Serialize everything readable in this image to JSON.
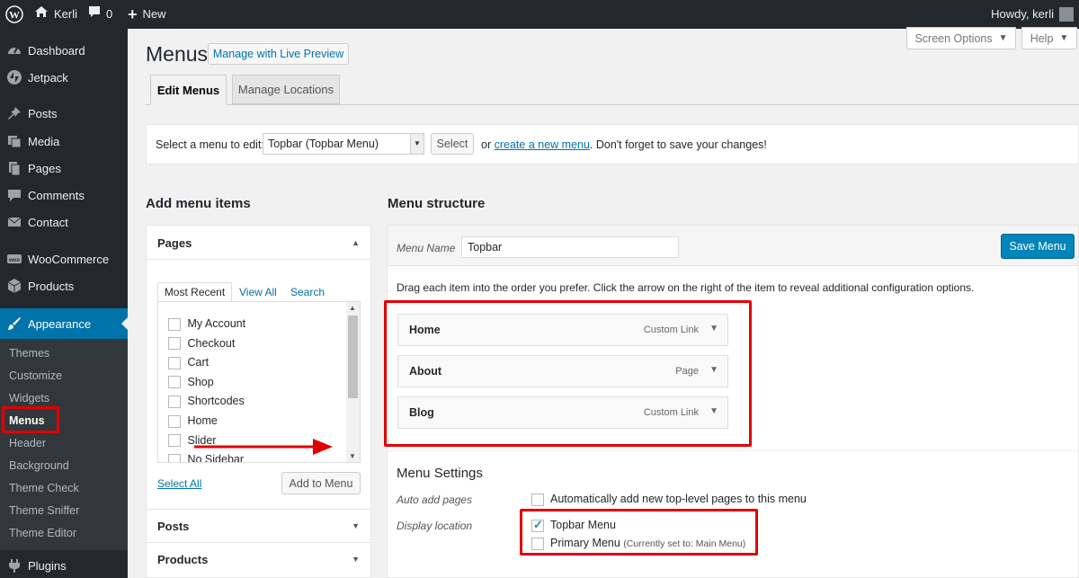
{
  "adminbar": {
    "site_name": "Kerli",
    "comments_count": "0",
    "new_label": "New",
    "howdy": "Howdy, kerli"
  },
  "sidebar": {
    "items": [
      {
        "label": "Dashboard",
        "icon": "dashboard-icon"
      },
      {
        "label": "Jetpack",
        "icon": "jetpack-icon"
      },
      {
        "label": "Posts",
        "icon": "pin-icon"
      },
      {
        "label": "Media",
        "icon": "media-icon"
      },
      {
        "label": "Pages",
        "icon": "pages-icon"
      },
      {
        "label": "Comments",
        "icon": "comment-icon"
      },
      {
        "label": "Contact",
        "icon": "mail-icon"
      },
      {
        "label": "WooCommerce",
        "icon": "woo-icon"
      },
      {
        "label": "Products",
        "icon": "box-icon"
      },
      {
        "label": "Appearance",
        "icon": "brush-icon"
      },
      {
        "label": "Plugins",
        "icon": "plugin-icon"
      }
    ],
    "appearance_sub": [
      "Themes",
      "Customize",
      "Widgets",
      "Menus",
      "Header",
      "Background",
      "Theme Check",
      "Theme Sniffer",
      "Theme Editor"
    ]
  },
  "header": {
    "title": "Menus",
    "live_preview": "Manage with Live Preview",
    "screen_options": "Screen Options",
    "help": "Help"
  },
  "tabs": [
    "Edit Menus",
    "Manage Locations"
  ],
  "select_bar": {
    "label": "Select a menu to edit:",
    "selected": "Topbar (Topbar Menu)",
    "select_button": "Select",
    "or": "or",
    "create_link": "create a new menu",
    "tail": ". Don't forget to save your changes!"
  },
  "add_items": {
    "heading": "Add menu items",
    "pages_title": "Pages",
    "subtabs": [
      "Most Recent",
      "View All",
      "Search"
    ],
    "pages": [
      "My Account",
      "Checkout",
      "Cart",
      "Shop",
      "Shortcodes",
      "Home",
      "Slider",
      "No Sidebar"
    ],
    "select_all": "Select All",
    "add_button": "Add to Menu",
    "other_sections": [
      "Posts",
      "Products"
    ]
  },
  "structure": {
    "heading": "Menu structure",
    "name_label": "Menu Name",
    "name_value": "Topbar",
    "save_button": "Save Menu",
    "instructions": "Drag each item into the order you prefer. Click the arrow on the right of the item to reveal additional configuration options.",
    "items": [
      {
        "title": "Home",
        "type": "Custom Link"
      },
      {
        "title": "About",
        "type": "Page"
      },
      {
        "title": "Blog",
        "type": "Custom Link"
      }
    ]
  },
  "settings": {
    "heading": "Menu Settings",
    "auto_label": "Auto add pages",
    "auto_text": "Automatically add new top-level pages to this menu",
    "location_label": "Display location",
    "locations": [
      {
        "label": "Topbar Menu",
        "note": "",
        "checked": true
      },
      {
        "label": "Primary Menu",
        "note": "(Currently set to: Main Menu)",
        "checked": false
      }
    ]
  },
  "colors": {
    "accent": "#0073aa",
    "highlight": "#e00000"
  }
}
